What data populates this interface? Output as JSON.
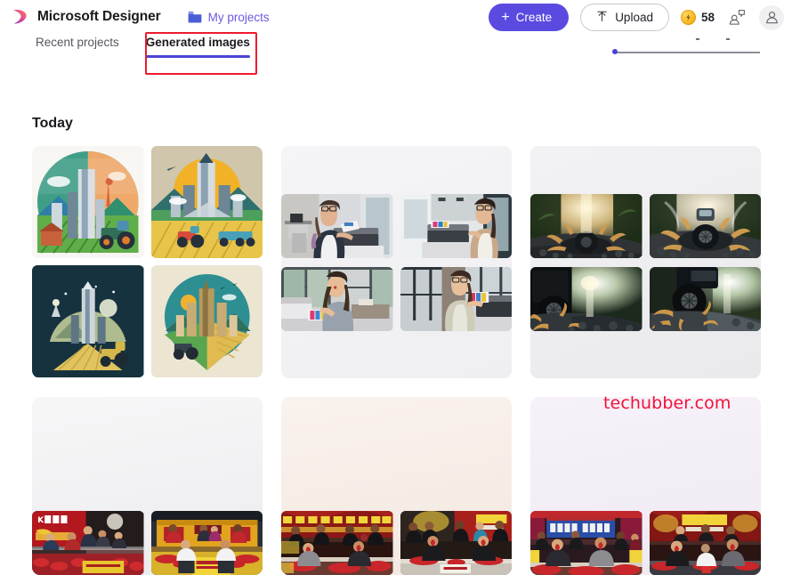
{
  "header": {
    "brand": "Microsoft Designer",
    "logo_icon": "designer-swirl-logo",
    "my_projects": {
      "label": "My projects",
      "icon": "folder-icon"
    },
    "create_button": {
      "label": "Create",
      "icon": "plus-icon",
      "color": "#5b4ae0"
    },
    "upload_button": {
      "label": "Upload",
      "icon": "upload-arrow-icon"
    },
    "credits": {
      "value": "58",
      "icon": "lightning-coin-icon",
      "color": "#f7b61f"
    },
    "feedback_icon": "feedback-person-icon",
    "avatar_icon": "account-avatar-icon"
  },
  "tabs": [
    {
      "label": "Recent projects",
      "active": false
    },
    {
      "label": "Generated images",
      "active": true
    }
  ],
  "annotation": {
    "target": "Generated images",
    "color": "#ee1b2e"
  },
  "main": {
    "section_title": "Today",
    "cards": [
      {
        "name": "green-city-agriculture-set",
        "layout": "square",
        "bg": "#ffffff",
        "images": [
          {
            "alt": "Flat illustration of green skyscraper city with farmland, tractor and mountains",
            "variant": "city-farm-1"
          },
          {
            "alt": "Illustration of tall city towers over golden wheat fields with tractor under orange sun",
            "variant": "city-farm-2"
          },
          {
            "alt": "Dark navy illustration of modern tower over farm fields at night",
            "variant": "city-farm-3"
          },
          {
            "alt": "Circular badge illustration of skyscrapers above green and gold farm fields",
            "variant": "city-farm-4"
          }
        ]
      },
      {
        "name": "office-printer-women-set",
        "layout": "wide",
        "bg": "#f3f3f5",
        "images": [
          {
            "alt": "Businesswoman in dark blazer with glasses at office printer",
            "variant": "office-1"
          },
          {
            "alt": "Woman in beige blazer feeding colour prints into a copier",
            "variant": "office-2"
          },
          {
            "alt": "Smiling woman in grey shirt holding colour print beside printer",
            "variant": "office-3"
          },
          {
            "alt": "Woman in cardigan collecting colour printouts from an office printer",
            "variant": "office-4"
          }
        ]
      },
      {
        "name": "offroad-tire-splash-set",
        "layout": "wide",
        "bg": "#efeff1",
        "images": [
          {
            "alt": "Tire splashing through muddy puddle on forest road with sun flare",
            "variant": "tire-1"
          },
          {
            "alt": "SUV wheel blasting water on wet jungle road",
            "variant": "tire-2"
          },
          {
            "alt": "Close-up of truck wheel spraying mud on dark road",
            "variant": "tire-3"
          },
          {
            "alt": "Off-road tire kicking up water beside a reflective puddle",
            "variant": "tire-4"
          }
        ]
      },
      {
        "name": "chilli-eating-contest-set-a",
        "layout": "wide-b",
        "bg": "#f0eff1",
        "images": [
          {
            "alt": "Contestants at a King Chilli eating competition table with red chillies",
            "variant": "chilli-1"
          },
          {
            "alt": "Two men at yellow chilli eating competition stage with red banner",
            "variant": "chilli-2"
          }
        ]
      },
      {
        "name": "chilli-eating-contest-set-b",
        "layout": "wide-b",
        "bg": "#f5eeea",
        "images": [
          {
            "alt": "Men eating chillies on stage under red and black contest banner",
            "variant": "chilli-3"
          },
          {
            "alt": "Competitors on stage with trays of red chillies and crowd behind",
            "variant": "chilli-4"
          }
        ]
      },
      {
        "name": "chilli-eating-contest-set-c",
        "layout": "wide-b",
        "bg": "#f2eef4",
        "images": [
          {
            "alt": "Two contestants reacting under a KINGG CHILLY blue banner",
            "variant": "chilli-5"
          },
          {
            "alt": "Men eating chillies under a King Chilli eating competition banner",
            "variant": "chilli-6"
          }
        ]
      }
    ]
  },
  "watermark": {
    "text": "techubber.com",
    "color": "#f2113a"
  }
}
